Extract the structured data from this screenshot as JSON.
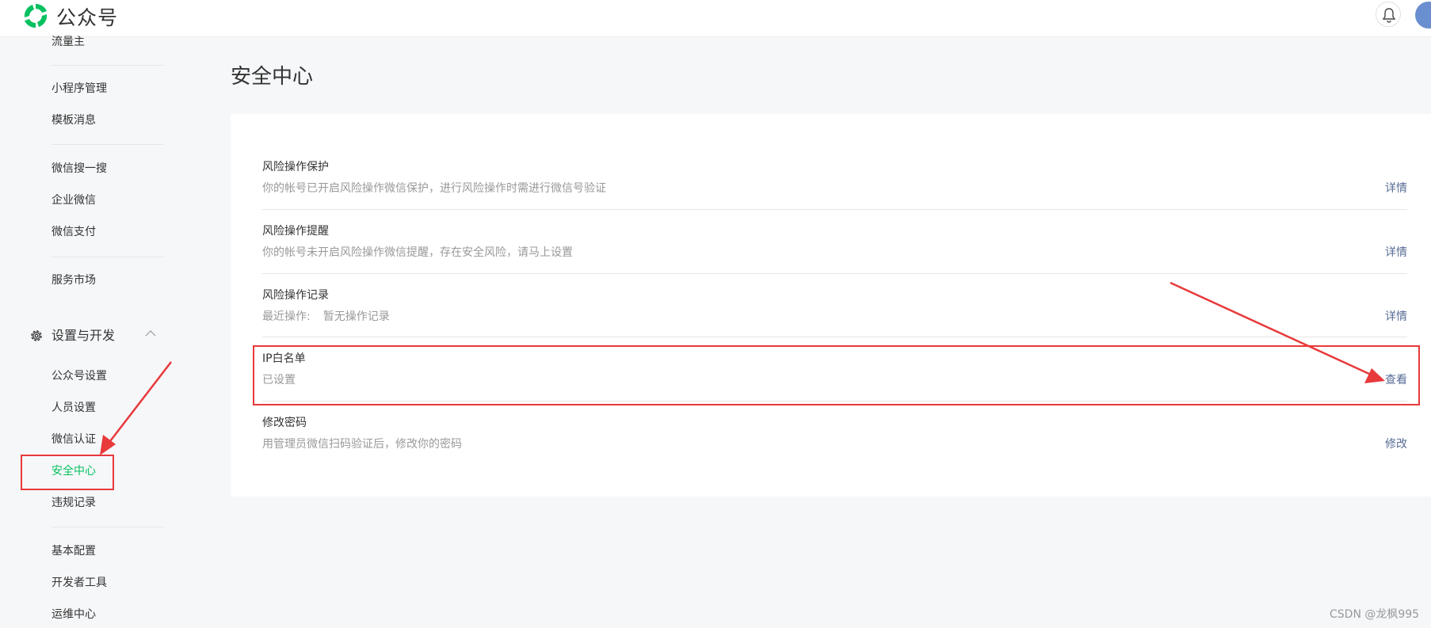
{
  "header": {
    "app_name": "公众号"
  },
  "sidebar": {
    "items": [
      {
        "label": "流量主"
      },
      {
        "label": "小程序管理"
      },
      {
        "label": "模板消息"
      },
      {
        "label": "微信搜一搜"
      },
      {
        "label": "企业微信"
      },
      {
        "label": "微信支付"
      },
      {
        "label": "服务市场"
      }
    ],
    "group": {
      "label": "设置与开发",
      "items": [
        {
          "label": "公众号设置"
        },
        {
          "label": "人员设置"
        },
        {
          "label": "微信认证"
        },
        {
          "label": "安全中心",
          "active": true
        },
        {
          "label": "违规记录"
        }
      ]
    },
    "extra_items": [
      {
        "label": "基本配置"
      },
      {
        "label": "开发者工具"
      },
      {
        "label": "运维中心"
      }
    ]
  },
  "main": {
    "title": "安全中心",
    "rows": [
      {
        "title": "风险操作保护",
        "desc": "你的帐号已开启风险操作微信保护，进行风险操作时需进行微信号验证",
        "action": "详情"
      },
      {
        "title": "风险操作提醒",
        "desc": "你的帐号未开启风险操作微信提醒，存在安全风险，请马上设置",
        "action": "详情"
      },
      {
        "title": "风险操作记录",
        "desc_label": "最近操作:",
        "desc_value": "暂无操作记录",
        "action": "详情"
      },
      {
        "title": "IP白名单",
        "desc": "已设置",
        "action": "查看"
      },
      {
        "title": "修改密码",
        "desc": "用管理员微信扫码验证后，修改你的密码",
        "action": "修改"
      }
    ]
  },
  "watermark": "CSDN @龙枫995",
  "colors": {
    "brand_green": "#07c160",
    "link_blue": "#576b95",
    "annotation_red": "#e8393b"
  },
  "icons": [
    "wechat-official-logo-icon",
    "bell-icon",
    "gear-icon",
    "chevron-up-icon"
  ]
}
